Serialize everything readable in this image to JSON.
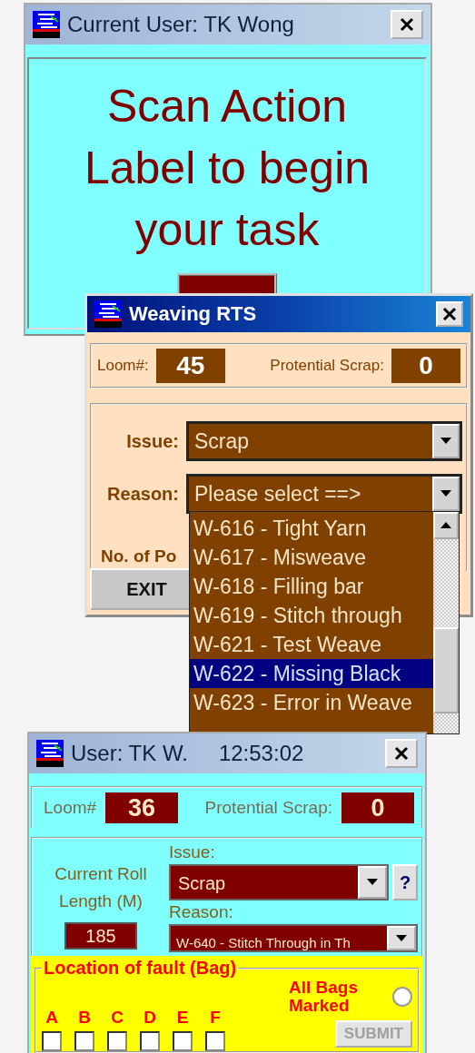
{
  "scan_window": {
    "title": "Current User: TK Wong",
    "message": "Scan Action Label to begin your task"
  },
  "rts_window": {
    "title": "Weaving RTS",
    "loom_label": "Loom#:",
    "loom": "45",
    "scrap_label": "Protential Scrap:",
    "scrap": "0",
    "issue_label": "Issue:",
    "issue": "Scrap",
    "reason_label": "Reason:",
    "reason": "Please select ==>",
    "count_label": "No. of Po",
    "exit_button": "EXIT",
    "reason_options": [
      {
        "label": "W-616 - Tight Yarn",
        "selected": false
      },
      {
        "label": "W-617 - Misweave",
        "selected": false
      },
      {
        "label": "W-618 - Filling bar",
        "selected": false
      },
      {
        "label": "W-619 - Stitch through",
        "selected": false
      },
      {
        "label": "W-621 - Test Weave",
        "selected": false
      },
      {
        "label": "W-622 - Missing Black",
        "selected": true
      },
      {
        "label": "W-623 - Error in Weave",
        "selected": false
      }
    ]
  },
  "roll_window": {
    "title": "User: TK W.",
    "time": "12:53:02",
    "loom_label": "Loom#",
    "loom": "36",
    "scrap_label": "Protential Scrap:",
    "scrap": "0",
    "roll_length_label": "Current Roll Length (M)",
    "roll_length": "185",
    "issue_label": "Issue:",
    "issue": "Scrap",
    "help_button": "?",
    "reason_label": "Reason:",
    "reason": "W-640 - Stitch Through in Th",
    "fault_group": {
      "legend": "Location of fault (Bag)",
      "bags": [
        {
          "label": "A",
          "checked": false
        },
        {
          "label": "B",
          "checked": false
        },
        {
          "label": "C",
          "checked": false
        },
        {
          "label": "D",
          "checked": false
        },
        {
          "label": "E",
          "checked": false
        },
        {
          "label": "F",
          "checked": false
        }
      ],
      "all_bags_label": "All Bags Marked",
      "all_bags_marked": false,
      "submit_button": "SUBMIT",
      "submit_disabled": true
    }
  }
}
